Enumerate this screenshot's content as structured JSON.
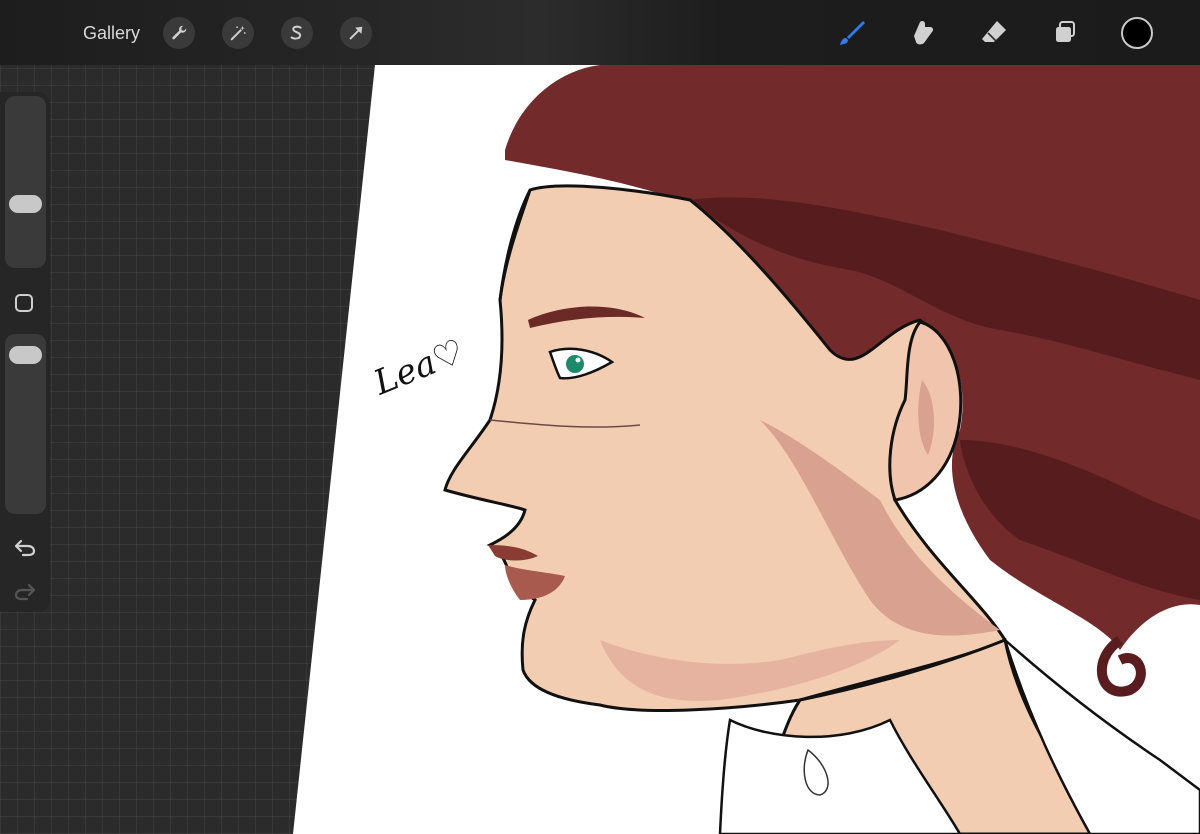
{
  "topbar": {
    "gallery_label": "Gallery",
    "actions_icon": "wrench-icon",
    "adjustments_icon": "magic-wand-icon",
    "selection_icon": "selection-s-icon",
    "transform_icon": "arrow-cursor-icon",
    "brush_icon": "brush-icon",
    "smudge_icon": "smudge-finger-icon",
    "eraser_icon": "eraser-icon",
    "layers_icon": "layers-icon",
    "active_color": "#000000",
    "active_tool_color": "#2f7bf0"
  },
  "sidebar": {
    "brush_size_level": 0.35,
    "opacity_level": 0.95,
    "modify_icon": "square-modify-icon",
    "undo_icon": "undo-icon",
    "redo_icon": "redo-icon"
  },
  "artwork": {
    "signature": "Lea♡",
    "palette": {
      "hair": "#722a2a",
      "hair_shadow": "#5a1d1f",
      "skin": "#f2cdb2",
      "skin_shadow": "#d79a8a",
      "lips": "#8a3b33",
      "eye": "#1a8a6b",
      "paper": "#ffffff"
    }
  }
}
